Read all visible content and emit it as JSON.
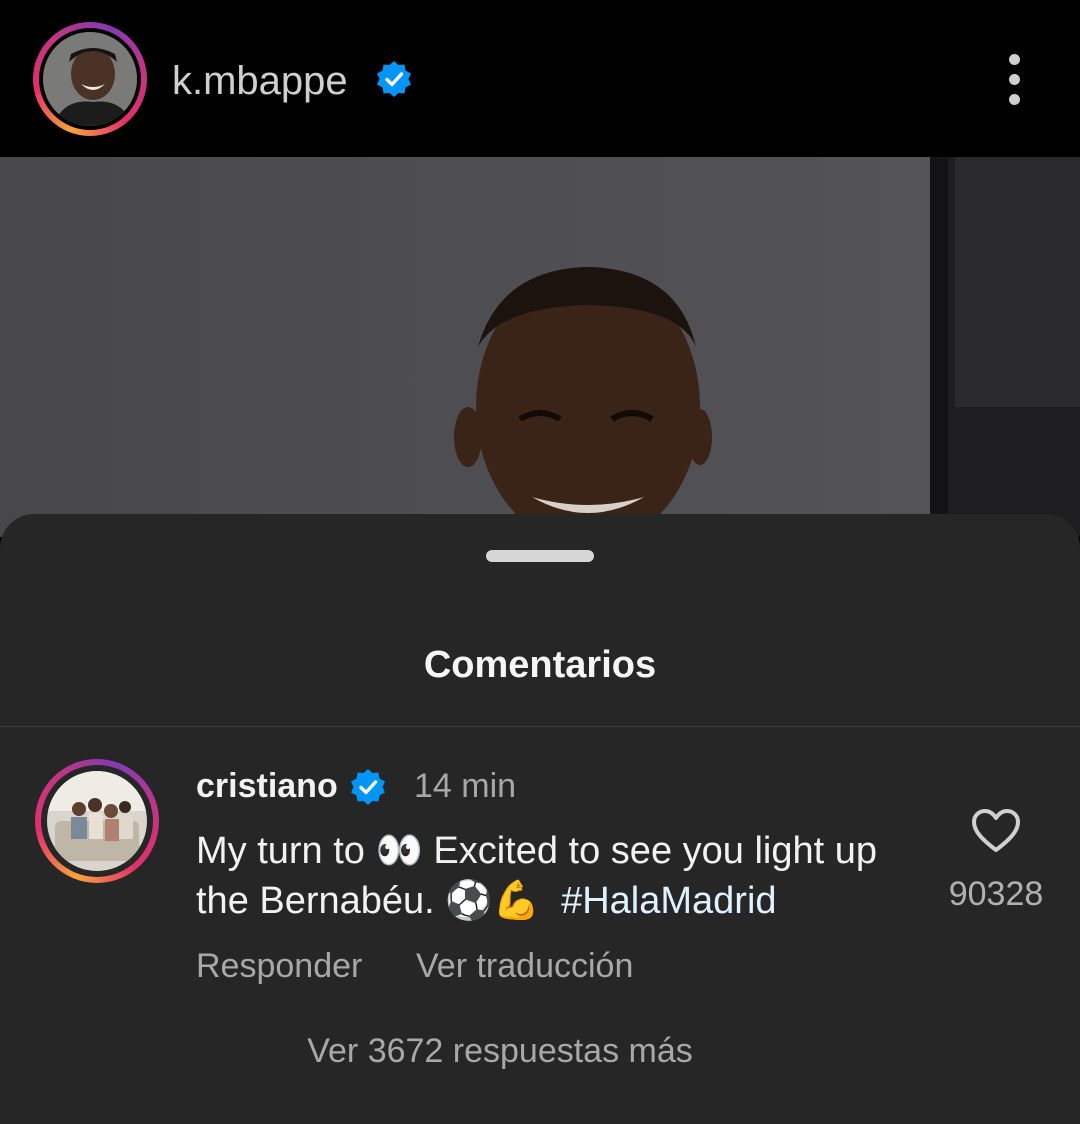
{
  "header": {
    "username": "k.mbappe",
    "verified_icon": "verified-badge-icon",
    "menu_icon": "more-vertical-icon"
  },
  "post": {
    "image": "post-photo"
  },
  "sheet": {
    "title": "Comentarios"
  },
  "comment": {
    "username": "cristiano",
    "time": "14 min",
    "text_part1": "My turn to ",
    "eyes_emoji": "👀",
    "text_part2": " Excited to see you light up the Bernabéu. ",
    "ball_emoji": "⚽",
    "muscle_emoji": "💪",
    "hashtag": "#HalaMadrid",
    "likes": "90328",
    "reply_label": "Responder",
    "translate_label": "Ver traducción",
    "more_replies": "Ver 3672 respuestas más"
  },
  "colors": {
    "background": "#000000",
    "sheet": "#262626",
    "verified": "#0095f6"
  }
}
